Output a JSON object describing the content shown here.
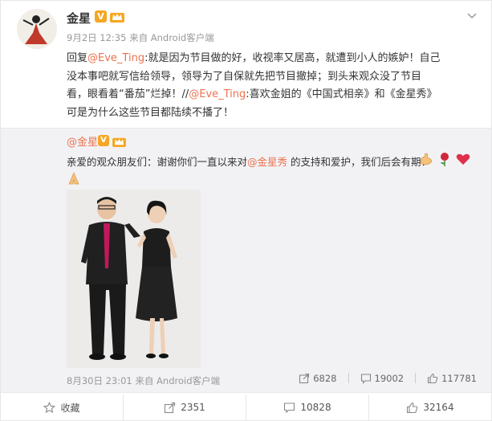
{
  "post": {
    "author": "金星",
    "verified_badge": "V",
    "timestamp": "9月2日 12:35 来自 Android客户端",
    "lines": [
      {
        "prefix": "回复",
        "mention": "@Eve_Ting",
        "text": ":就是因为节目做的好，收视率又居高，就遭到小人的嫉妒！自己"
      },
      {
        "text": "没本事吧就写信给领导，领导为了自保就先把节目撤掉；到头来观众没了节目"
      },
      {
        "text": "看，眼看着“番茄”烂掉！//",
        "mention": "@Eve_Ting",
        "suffix": ":喜欢金姐的《中国式相亲》和《金星秀》"
      },
      {
        "text": "可是为什么这些节目都陆续不播了！"
      }
    ]
  },
  "repost": {
    "author": "@金星",
    "verified_badge": "V",
    "text_before": "亲爱的观众朋友们：谢谢你们一直以来对",
    "mention": "@金星秀",
    "text_after": " 的支持和爱护，我们后会有期！",
    "emojis": [
      "muscle-emoji",
      "rose-emoji",
      "heart-emoji"
    ],
    "second_line_emoji": "pray-emoji",
    "timestamp": "8月30日 23:01 来自 Android客户端",
    "stats": {
      "reposts": "6828",
      "comments": "19002",
      "likes": "117781"
    }
  },
  "actions": {
    "collect": "收藏",
    "repost": "2351",
    "comment": "10828",
    "like": "32164"
  },
  "colors": {
    "accent": "#eb7350",
    "badge": "#f5a623",
    "meta": "#999999"
  }
}
